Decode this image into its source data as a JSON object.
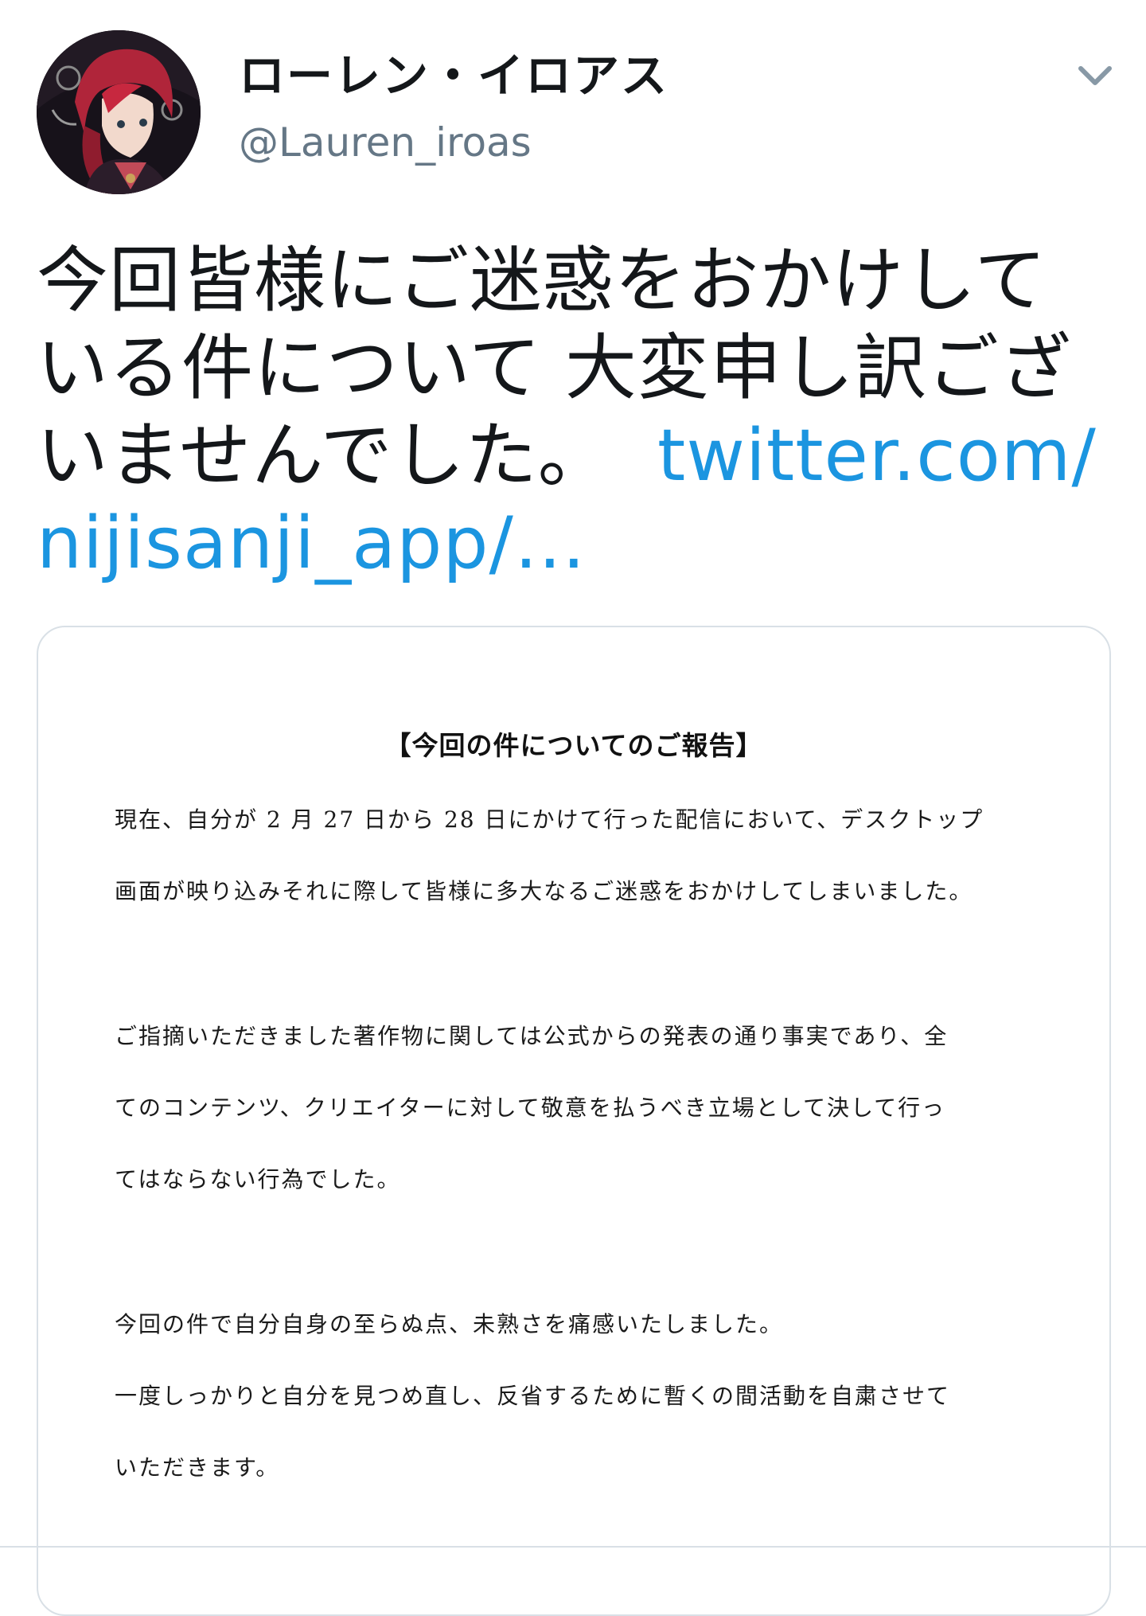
{
  "user": {
    "display_name": "ローレン・イロアス",
    "handle": "@Lauren_iroas"
  },
  "tweet": {
    "text_line1": "今回皆様にご迷惑をおかけして",
    "text_line2": "いる件について 大変申し訳ござ",
    "text_line3": "いませんでした。",
    "link_part1": "twitter.com/",
    "link_part2": "nijisanji_app/…"
  },
  "document": {
    "title": "【今回の件についてのご報告】",
    "lines": [
      "現在、自分が 2 月 27 日から 28 日にかけて行った配信において、デスクトップ",
      "画面が映り込みそれに際して皆様に多大なるご迷惑をおかけしてしまいました。",
      "ご指摘いただきました著作物に関しては公式からの発表の通り事実であり、全",
      "てのコンテンツ、クリエイターに対して敬意を払うべき立場として決して行っ",
      "てはならない行為でした。",
      "今回の件で自分自身の至らぬ点、未熟さを痛感いたしました。",
      "一度しっかりと自分を見つめ直し、反省するために暫くの間活動を自粛させて",
      "いただきます。"
    ]
  },
  "icons": {
    "caret": "chevron-down-icon",
    "avatar": "profile-avatar"
  },
  "colors": {
    "link": "#1b95e0",
    "handle": "#657786",
    "text": "#14171a",
    "border": "#d9e0e6"
  }
}
